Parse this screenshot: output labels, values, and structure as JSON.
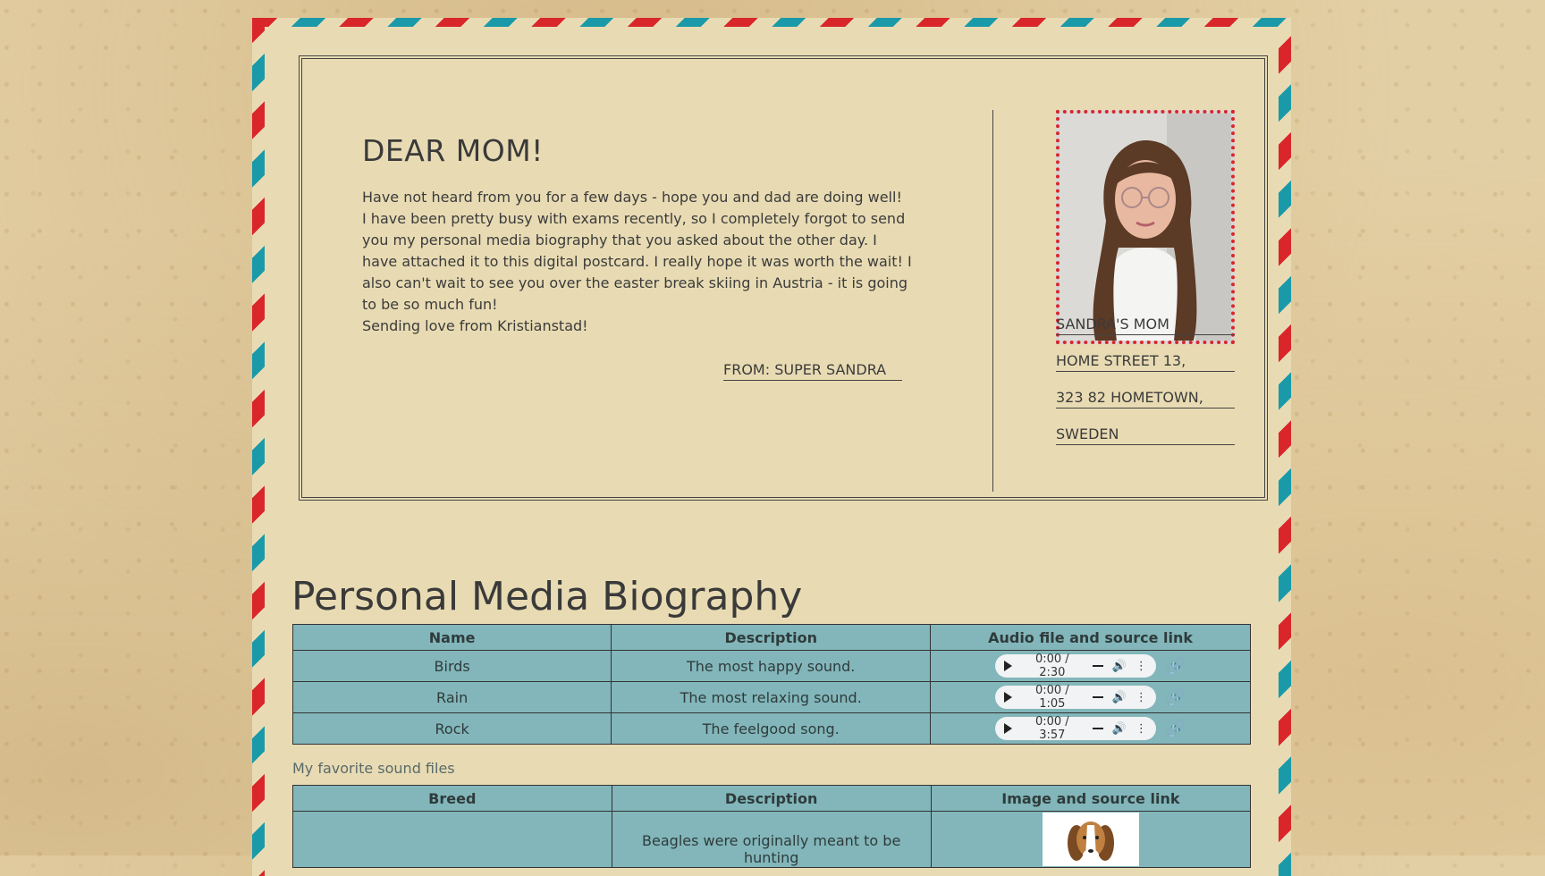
{
  "letter": {
    "greeting": "DEAR MOM!",
    "paragraphs": [
      "Have not heard from you for a few days - hope you and dad are doing well!",
      "I have been pretty busy with exams recently, so I completely forgot to send you my personal media biography that you asked about the other day. I have attached it to this digital postcard. I really hope it was worth the wait! I also can't wait to see you over the easter break skiing in Austria - it is going to be so much fun!",
      "Sending love from Kristianstad!"
    ],
    "from": "FROM: SUPER SANDRA"
  },
  "address": {
    "lines": [
      "SANDRA'S MOM",
      "HOME STREET 13,",
      "323 82 HOMETOWN,",
      "SWEDEN"
    ]
  },
  "colors": {
    "red_stripe": "#d9262b",
    "teal_stripe": "#1a9aa8",
    "table_bg": "#82b6ba",
    "paper": "#e8dbb3"
  },
  "biography": {
    "title": "Personal Media Biography",
    "sound_table": {
      "headers": [
        "Name",
        "Description",
        "Audio file and source link"
      ],
      "rows": [
        {
          "name": "Birds",
          "description": "The most happy sound.",
          "time": "0:00 / 2:30"
        },
        {
          "name": "Rain",
          "description": "The most relaxing sound.",
          "time": "0:00 / 1:05"
        },
        {
          "name": "Rock",
          "description": "The feelgood song.",
          "time": "0:00 / 3:57"
        }
      ],
      "caption": "My favorite sound files"
    },
    "dog_table": {
      "headers": [
        "Breed",
        "Description",
        "Image and source link"
      ],
      "rows": [
        {
          "breed": "",
          "description": "Beagles were originally meant to be hunting"
        }
      ]
    }
  },
  "icons": {
    "link": "link-icon",
    "play": "play-icon",
    "volume": "volume-icon",
    "menu": "more-vert-icon"
  }
}
